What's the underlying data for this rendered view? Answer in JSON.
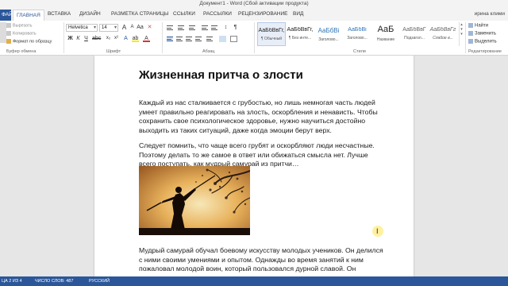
{
  "window": {
    "title": "Документ1 - Word (Сбой активации продукта)"
  },
  "tabs": {
    "file": "ФАЙЛ",
    "items": [
      "ГЛАВНАЯ",
      "ВСТАВКА",
      "ДИЗАЙН",
      "РАЗМЕТКА СТРАНИЦЫ",
      "ССЫЛКИ",
      "РАССЫЛКИ",
      "РЕЦЕНЗИРОВАНИЕ",
      "ВИД"
    ],
    "user": "ирина клими"
  },
  "clipboard": {
    "cut": "Вырезать",
    "copy": "Копировать",
    "format_painter": "Формат по образцу",
    "group_label": "Буфер обмена"
  },
  "font": {
    "family": "Helvetica",
    "size": "14",
    "group_label": "Шрифт"
  },
  "paragraph": {
    "group_label": "Абзац"
  },
  "styles": {
    "group_label": "Стили",
    "items": [
      {
        "sample": "АаБбВвГг,",
        "name": "¶ Обычный"
      },
      {
        "sample": "АаБбВвГг,",
        "name": "¶ Без инте..."
      },
      {
        "sample": "АаБбВі",
        "name": "Заголово..."
      },
      {
        "sample": "АаБбВі",
        "name": "Заголово..."
      },
      {
        "sample": "АаБ",
        "name": "Название"
      },
      {
        "sample": "АаБбВвГ",
        "name": "Подзагол..."
      },
      {
        "sample": "АаБбВвГг",
        "name": "Слабое в..."
      }
    ]
  },
  "editing": {
    "find": "Найти",
    "replace": "Заменить",
    "select": "Выделить",
    "group_label": "Редактирование"
  },
  "document": {
    "title": "Жизненная притча о злости",
    "paragraphs": [
      "Каждый из нас сталкивается с грубостью, но лишь немногая часть людей умеет правильно реагировать на злость, оскорбления и ненависть. Чтобы сохранить свое психологическое здоровье, нужно научиться достойно выходить из таких ситуаций, даже когда эмоции берут верх.",
      "Следует помнить, что чаще всего грубят и оскорбляют люди несчастные. Поэтому делать то же самое в ответ или обижаться смысла нет. Лучше всего поступать, как мудрый самурай из притчи…",
      "Мудрый самурай обучал боевому искусству молодых учеников. Он делился с ними своими умениями и опытом. Однажды во время занятий к ним пожаловал молодой воин, который пользовался дурной славой. Он «прославился» своими дерзостью и жестокостью."
    ]
  },
  "status": {
    "page": "ЦА 2 ИЗ 4",
    "words": "ЧИСЛО СЛОВ: 487",
    "language": "РУССКИЙ"
  }
}
